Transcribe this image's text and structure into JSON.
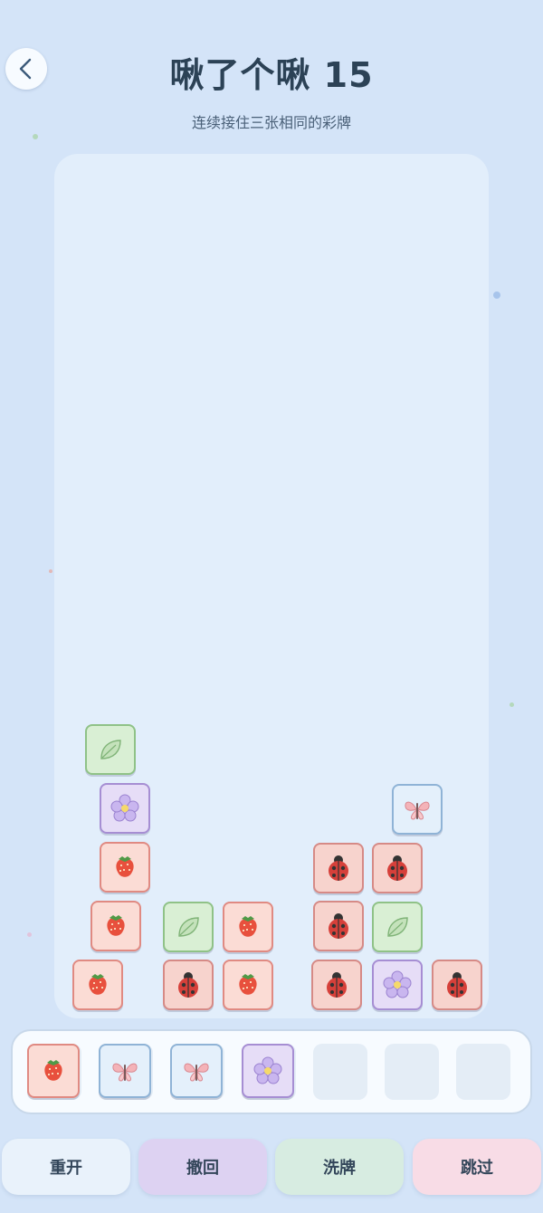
{
  "header": {
    "title": "啾了个啾 15",
    "subtitle": "连续接住三张相同的彩牌"
  },
  "board": {
    "tiles": [
      {
        "icon": "leaf"
      },
      {
        "icon": "flower"
      },
      {
        "icon": "strawberry"
      },
      {
        "icon": "strawberry"
      },
      {
        "icon": "strawberry"
      },
      {
        "icon": "leaf"
      },
      {
        "icon": "ladybug"
      },
      {
        "icon": "strawberry"
      },
      {
        "icon": "strawberry"
      },
      {
        "icon": "ladybug"
      },
      {
        "icon": "ladybug"
      },
      {
        "icon": "ladybug"
      },
      {
        "icon": "butterfly"
      },
      {
        "icon": "ladybug"
      },
      {
        "icon": "leaf"
      },
      {
        "icon": "flower"
      },
      {
        "icon": "ladybug"
      }
    ]
  },
  "tray": {
    "capacity": 7,
    "slots": [
      "strawberry",
      "butterfly",
      "butterfly",
      "flower"
    ]
  },
  "actions": {
    "restart": "重开",
    "undo": "撤回",
    "shuffle": "洗牌",
    "skip": "跳过"
  },
  "colors": {
    "background": "#d4e4f8",
    "board": "#e2eefb",
    "restart": "#e9f2fb",
    "undo": "#ddd2f2",
    "shuffle": "#d7ece1",
    "skip": "#f8dce6"
  }
}
